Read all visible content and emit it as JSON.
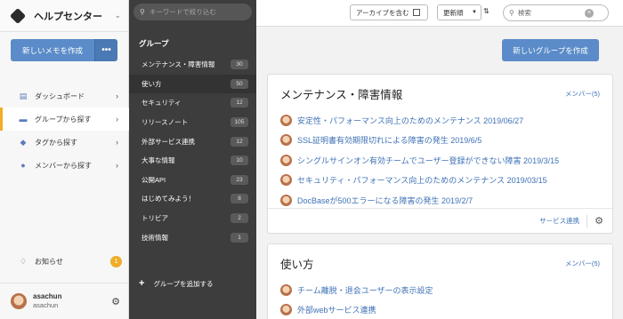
{
  "brand": {
    "title": "ヘルプセンター"
  },
  "sidebar": {
    "new_memo_label": "新しいメモを作成",
    "more_label": "•••",
    "items": [
      {
        "label": "ダッシュボード",
        "icon": "dashboard-icon",
        "active": false
      },
      {
        "label": "グループから探す",
        "icon": "folder-icon",
        "active": true
      },
      {
        "label": "タグから探す",
        "icon": "tag-icon",
        "active": false
      },
      {
        "label": "メンバーから探す",
        "icon": "person-icon",
        "active": false
      }
    ],
    "notice": {
      "label": "お知らせ",
      "count": "1"
    },
    "user": {
      "name": "asachun",
      "id": "asachun"
    }
  },
  "groups": {
    "search_placeholder": "キーワードで絞り込む",
    "heading": "グループ",
    "items": [
      {
        "label": "メンテナンス・障害情報",
        "count": "30"
      },
      {
        "label": "使い方",
        "count": "50"
      },
      {
        "label": "セキュリティ",
        "count": "12"
      },
      {
        "label": "リリースノート",
        "count": "105"
      },
      {
        "label": "外部サービス連携",
        "count": "12"
      },
      {
        "label": "大事な情報",
        "count": "10"
      },
      {
        "label": "公開API",
        "count": "23"
      },
      {
        "label": "はじめてみよう！",
        "count": "8"
      },
      {
        "label": "トリビア",
        "count": "2"
      },
      {
        "label": "技術情報",
        "count": "1"
      }
    ],
    "add_label": "グループを追加する"
  },
  "topbar": {
    "archive_label": "アーカイブを含む",
    "sort_label": "更新順",
    "sort_direction": "⇅",
    "search_placeholder": "検索"
  },
  "main": {
    "new_group_label": "新しいグループを作成",
    "cards": [
      {
        "title": "メンテナンス・障害情報",
        "member_label": "メンバー(5)",
        "memos": [
          "安定性・パフォーマンス向上のためのメンテナンス 2019/06/27",
          "SSL証明書有効期限切れによる障害の発生 2019/6/5",
          "シングルサインオン有効チームでユーザー登録ができない障害 2019/3/15",
          "セキュリティ・パフォーマンス向上のためのメンテナンス 2019/03/15",
          "DocBaseが500エラーになる障害の発生 2019/2/7"
        ],
        "footer_link": "サービス連携"
      },
      {
        "title": "使い方",
        "member_label": "メンバー(5)",
        "memos": [
          "チーム離脱・退会ユーザーの表示設定",
          "外部webサービス連携"
        ]
      }
    ]
  },
  "colors": {
    "accent": "#5b8cc9",
    "link": "#3f72b6",
    "dark_panel": "#3d3d3d",
    "active_marker": "#f0ad29"
  }
}
